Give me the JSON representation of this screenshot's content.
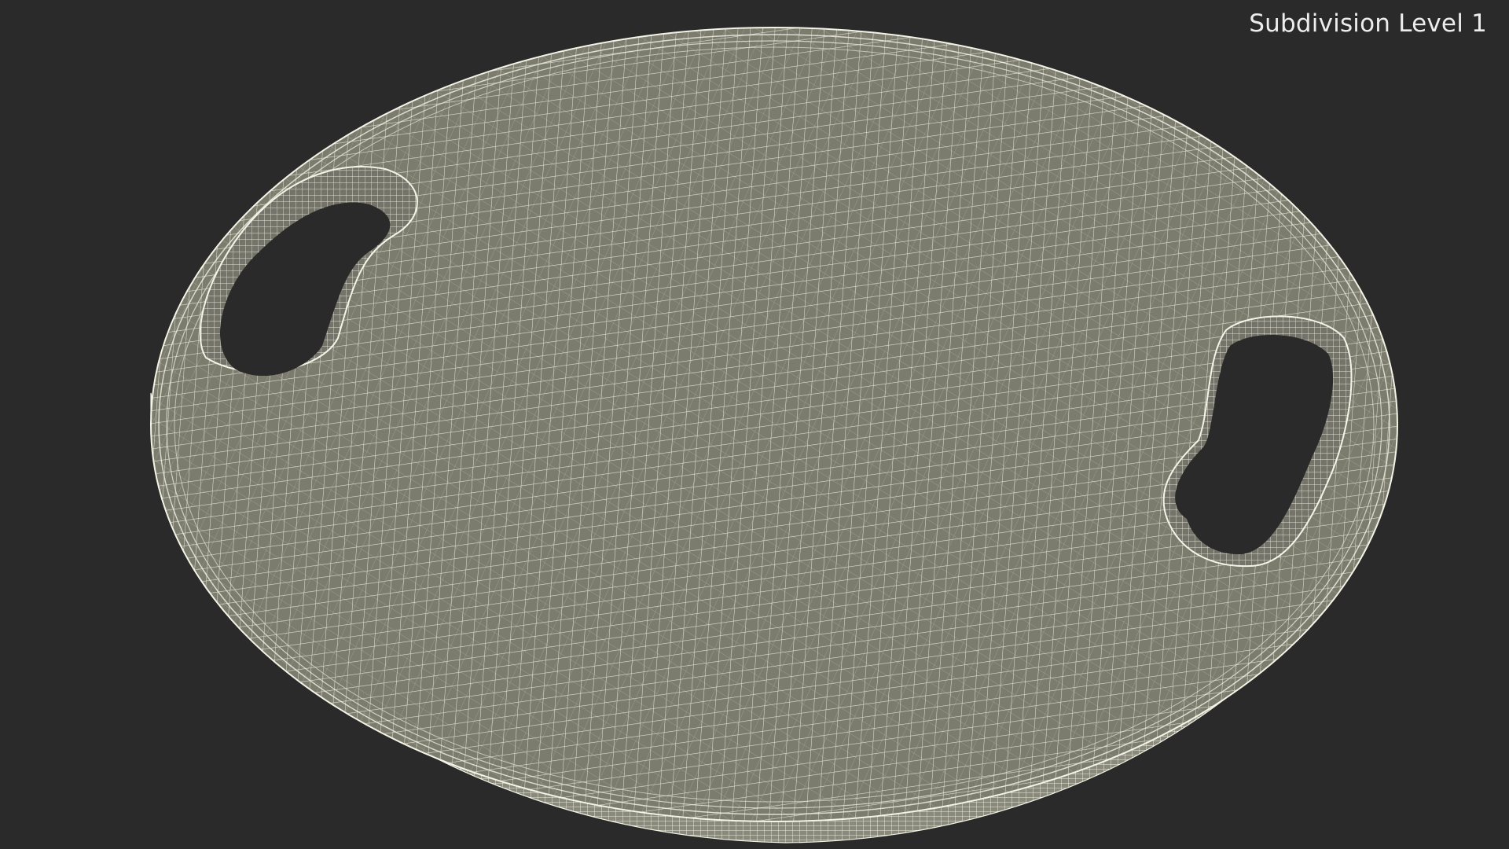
{
  "overlay": {
    "label": "Subdivision Level 1"
  },
  "scene": {
    "subject": "wireframe-balance-board",
    "colors": {
      "background": "#2a2a2a",
      "surface": "#7c7c6e",
      "rim": "#8a8a7c",
      "wire": "#f4f4e6",
      "hole": "#2a2a2a"
    }
  }
}
